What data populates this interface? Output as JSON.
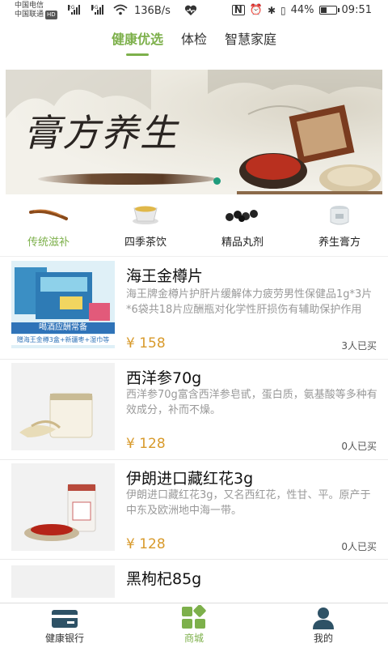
{
  "status": {
    "carrier1": "中国电信",
    "carrier2": "中国联通",
    "hd": "HD",
    "net1": "2G",
    "net2": "4G",
    "speed": "136B/s",
    "battery": "44%",
    "battery_level": 0.44,
    "time": "09:51"
  },
  "tabs": [
    {
      "label": "健康优选",
      "active": true
    },
    {
      "label": "体检",
      "active": false
    },
    {
      "label": "智慧家庭",
      "active": false
    }
  ],
  "banner": {
    "title": "膏方养生"
  },
  "categories": [
    {
      "label": "传统滋补",
      "icon": "herb-root-icon",
      "active": true
    },
    {
      "label": "四季茶饮",
      "icon": "tea-cup-icon",
      "active": false
    },
    {
      "label": "精品丸剂",
      "icon": "pills-icon",
      "active": false
    },
    {
      "label": "养生膏方",
      "icon": "jar-icon",
      "active": false
    }
  ],
  "products": [
    {
      "name": "海王金樽片",
      "desc": "海王牌金樽片护肝片缓解体力疲劳男性保健品1g*3片*6袋共18片应酬瓶对化学性肝损伤有辅助保护作用",
      "price": "¥ 158",
      "sold": "3人已买",
      "thumb_caption1": "喝酒应酬常备",
      "thumb_caption2": "赠海王金樽3盒+新疆枣+湿巾等"
    },
    {
      "name": "西洋参70g",
      "desc": "西洋参70g富含西洋参皂甙，蛋白质，氨基酸等多种有效成分，补而不燥。",
      "price": "¥ 128",
      "sold": "0人已买"
    },
    {
      "name": "伊朗进口藏红花3g",
      "desc": "伊朗进口藏红花3g，又名西红花，性甘、平。原产于中东及欧洲地中海一带。",
      "price": "¥ 128",
      "sold": "0人已买"
    },
    {
      "name": "黑枸杞85g",
      "desc": "",
      "price": "",
      "sold": ""
    }
  ],
  "bottom_nav": [
    {
      "label": "健康银行",
      "icon": "card-icon",
      "active": false
    },
    {
      "label": "商城",
      "icon": "grid-icon",
      "active": true
    },
    {
      "label": "我的",
      "icon": "person-icon",
      "active": false
    }
  ],
  "colors": {
    "accent": "#7db04b",
    "price": "#d89a2b",
    "desc": "#999999",
    "icon_dark": "#2e5266"
  }
}
